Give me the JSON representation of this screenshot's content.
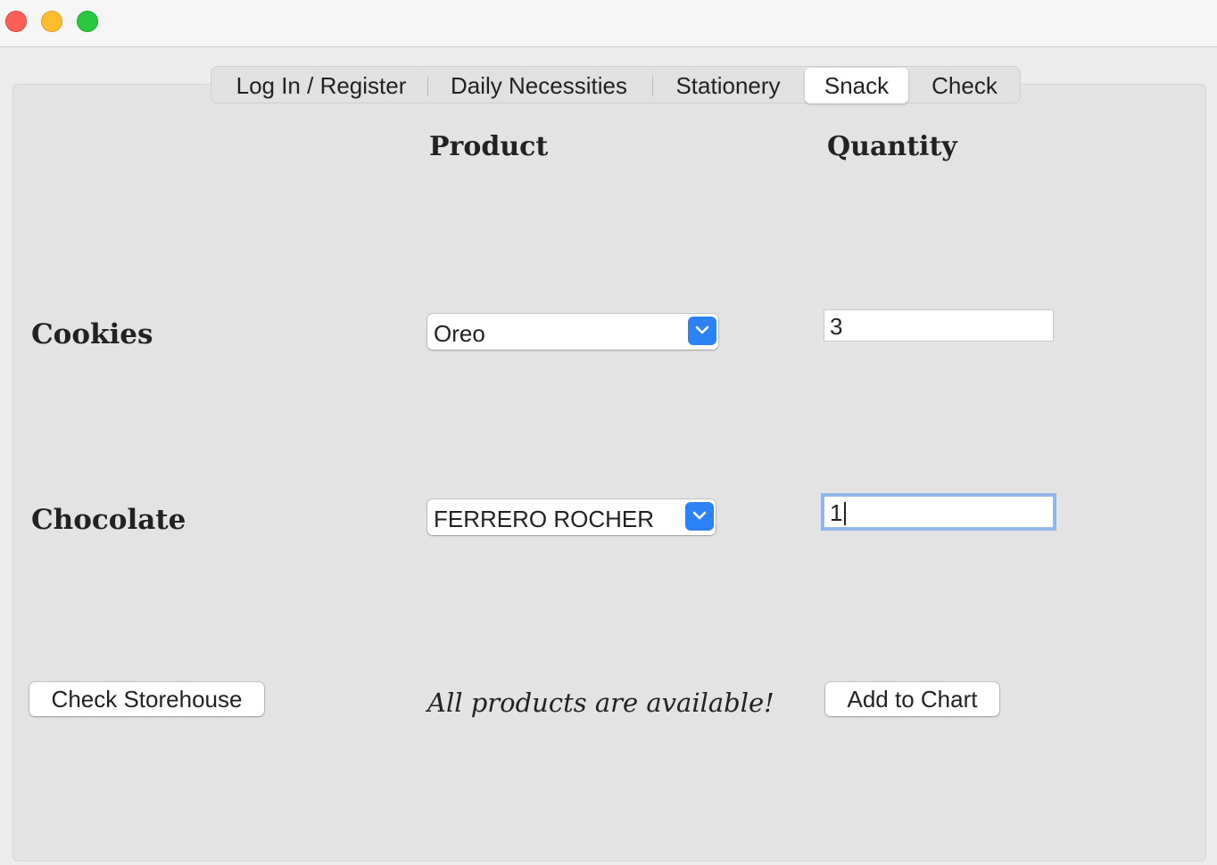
{
  "window": {
    "controls": [
      "close",
      "minimize",
      "maximize"
    ]
  },
  "tabs": [
    {
      "label": "Log In / Register",
      "active": false
    },
    {
      "label": "Daily Necessities",
      "active": false
    },
    {
      "label": "Stationery",
      "active": false
    },
    {
      "label": "Snack",
      "active": true
    },
    {
      "label": "Check",
      "active": false
    }
  ],
  "headers": {
    "product": "Product",
    "quantity": "Quantity"
  },
  "rows": [
    {
      "category": "Cookies",
      "product": "Oreo",
      "quantity": "3"
    },
    {
      "category": "Chocolate",
      "product": "FERRERO ROCHER",
      "quantity": "1"
    }
  ],
  "actions": {
    "check_storehouse": "Check Storehouse",
    "add_to_chart": "Add to Chart"
  },
  "status_message": "All products are available!",
  "colors": {
    "accent": "#2b82f6",
    "focus_ring": "#8fb4ee"
  },
  "icons": {
    "dropdown": "chevron-down-icon"
  }
}
